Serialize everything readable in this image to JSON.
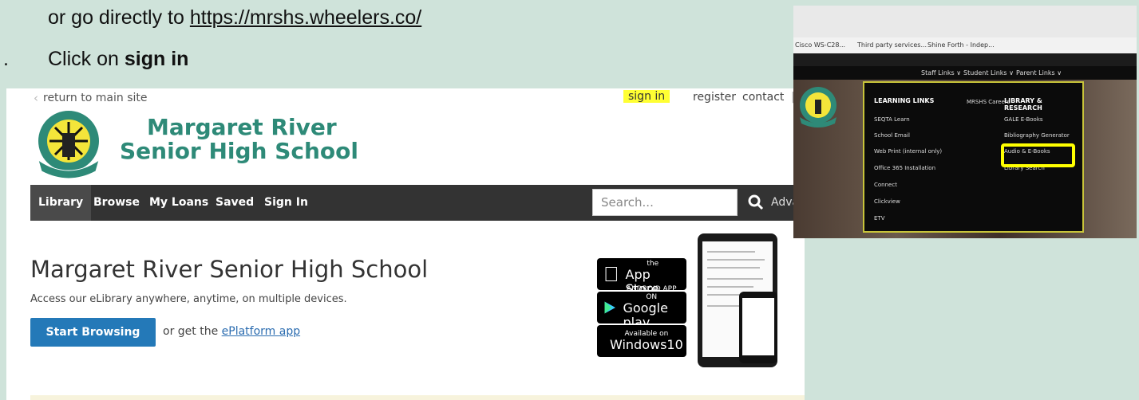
{
  "instructions": {
    "line1_prefix": "or go directly to ",
    "url": "https://mrshs.wheelers.co/",
    "step_number": ".",
    "line2_prefix": "Click on ",
    "line2_bold": "sign in"
  },
  "main_site": {
    "return_link": "return to main site",
    "top_links": {
      "sign_in": "sign in",
      "register": "register",
      "contact": "contact"
    },
    "school_name_line1": "Margaret River",
    "school_name_line2": "Senior High School",
    "logo_motto": "Shine Forth",
    "nav": {
      "items": [
        "Library",
        "Browse",
        "My Loans",
        "Saved",
        "Sign In"
      ],
      "search_placeholder": "Search...",
      "advanced": "Adva"
    },
    "page_title": "Margaret River Senior High School",
    "subtitle": "Access our eLibrary anywhere, anytime, on multiple devices.",
    "start_button": "Start Browsing",
    "or_get_prefix": "or get the ",
    "eplatform_link": "ePlatform app",
    "badges": {
      "appstore": {
        "small": "Download on the",
        "big": "App Store"
      },
      "googleplay": {
        "small": "ANDROID APP ON",
        "big": "Google play"
      },
      "windows": {
        "small": "Available on",
        "big": "Windows10"
      }
    }
  },
  "side_screenshot": {
    "bookmarks": [
      "Cisco WS-C28...",
      "Third party services...",
      "Shine Forth - Indep..."
    ],
    "nav": [
      "Staff Links ∨",
      "Student Links ∨",
      "Parent Links ∨"
    ],
    "columns": {
      "learning": {
        "head": "LEARNING LINKS",
        "items": [
          "SEQTA Learn",
          "School Email",
          "Web Print (internal only)",
          "Office 365 Installation",
          "Connect",
          "Clickview",
          "ETV"
        ]
      },
      "careers": {
        "head": "MRSHS Careers"
      },
      "library": {
        "head": "LIBRARY & RESEARCH",
        "items": [
          "GALE E-Books",
          "Bibliography Generator",
          "Audio & E-Books",
          "Library Search"
        ]
      }
    }
  },
  "colors": {
    "background": "#cfe3da",
    "school_green": "#2e8a78",
    "nav_dark": "#333333",
    "button_blue": "#2479b8",
    "highlight_yellow": "#ffff33"
  }
}
